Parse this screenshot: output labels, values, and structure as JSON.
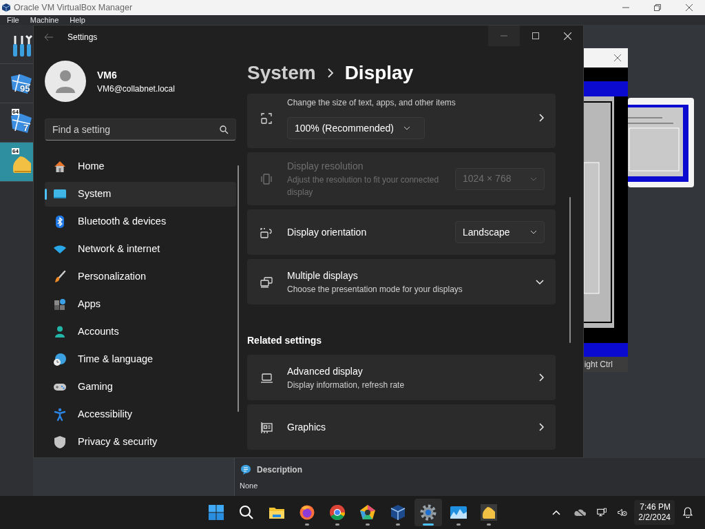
{
  "vbox": {
    "title": "Oracle VM VirtualBox Manager",
    "menu": [
      "File",
      "Machine",
      "Help"
    ],
    "vms": [
      {
        "label": "95",
        "selected": false
      },
      {
        "badge": "64",
        "label": "7",
        "selected": false
      },
      {
        "badge": "64",
        "selected": true
      }
    ],
    "details": {
      "heading": "Description",
      "value": "None"
    }
  },
  "vm_window": {
    "status": "ight Ctrl"
  },
  "settings": {
    "title": "Settings",
    "user": {
      "name": "VM6",
      "email": "VM6@collabnet.local"
    },
    "search": {
      "placeholder": "Find a setting"
    },
    "nav": [
      {
        "label": "Home",
        "selected": false
      },
      {
        "label": "System",
        "selected": true
      },
      {
        "label": "Bluetooth & devices",
        "selected": false
      },
      {
        "label": "Network & internet",
        "selected": false
      },
      {
        "label": "Personalization",
        "selected": false
      },
      {
        "label": "Apps",
        "selected": false
      },
      {
        "label": "Accounts",
        "selected": false
      },
      {
        "label": "Time & language",
        "selected": false
      },
      {
        "label": "Gaming",
        "selected": false
      },
      {
        "label": "Accessibility",
        "selected": false
      },
      {
        "label": "Privacy & security",
        "selected": false
      }
    ],
    "breadcrumb": [
      "System",
      "Display"
    ],
    "cards": [
      {
        "kind": "scale",
        "description": "Change the size of text, apps, and other items",
        "dropdown": "100% (Recommended)",
        "disabled": false
      },
      {
        "kind": "dropdown",
        "title": "Display resolution",
        "description": "Adjust the resolution to fit your connected display",
        "dropdown": "1024 × 768",
        "disabled": true
      },
      {
        "kind": "dropdown",
        "title": "Display orientation",
        "dropdown": "Landscape",
        "disabled": false
      },
      {
        "kind": "expander",
        "title": "Multiple displays",
        "description": "Choose the presentation mode for your displays",
        "expanded": false,
        "disabled": false
      }
    ],
    "related_heading": "Related settings",
    "related": [
      {
        "title": "Advanced display",
        "description": "Display information, refresh rate"
      },
      {
        "title": "Graphics"
      }
    ]
  },
  "taskbar": {
    "apps": [
      {
        "running": false,
        "active": false
      },
      {
        "running": true,
        "active": false
      },
      {
        "running": true,
        "active": false
      },
      {
        "running": true,
        "active": false
      },
      {
        "running": true,
        "active": false
      },
      {
        "running": true,
        "active": true
      },
      {
        "running": true,
        "active": false
      },
      {
        "running": true,
        "active": false
      }
    ],
    "time": "7:46 PM",
    "date": "2/2/2024"
  }
}
